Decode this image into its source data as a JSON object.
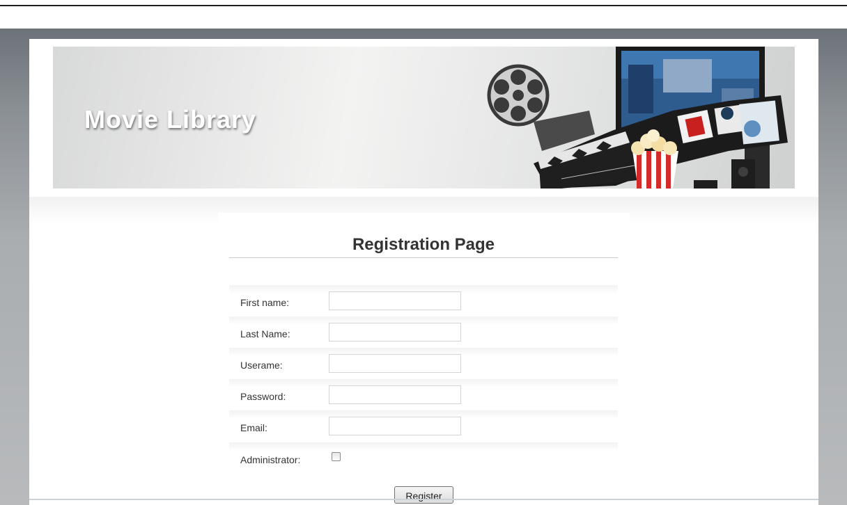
{
  "header": {
    "title": "Movie Library"
  },
  "form": {
    "title": "Registration Page",
    "fields": [
      {
        "label": "First name:",
        "value": "",
        "type": "text"
      },
      {
        "label": "Last Name:",
        "value": "",
        "type": "text"
      },
      {
        "label": "Userame:",
        "value": "",
        "type": "text"
      },
      {
        "label": "Password:",
        "value": "",
        "type": "password"
      },
      {
        "label": "Email:",
        "value": "",
        "type": "text"
      }
    ],
    "administrator": {
      "label": "Administrator:",
      "checked": false
    },
    "submit_label": "Register"
  },
  "icons": [
    "film-reel-icon",
    "clapperboard-icon",
    "popcorn-icon",
    "monitor-icon",
    "film-strip-icon",
    "speaker-icon"
  ],
  "colors": {
    "outer_background": "#9a9fa3",
    "banner_title": "#ffffff",
    "heading_text": "#333333"
  }
}
